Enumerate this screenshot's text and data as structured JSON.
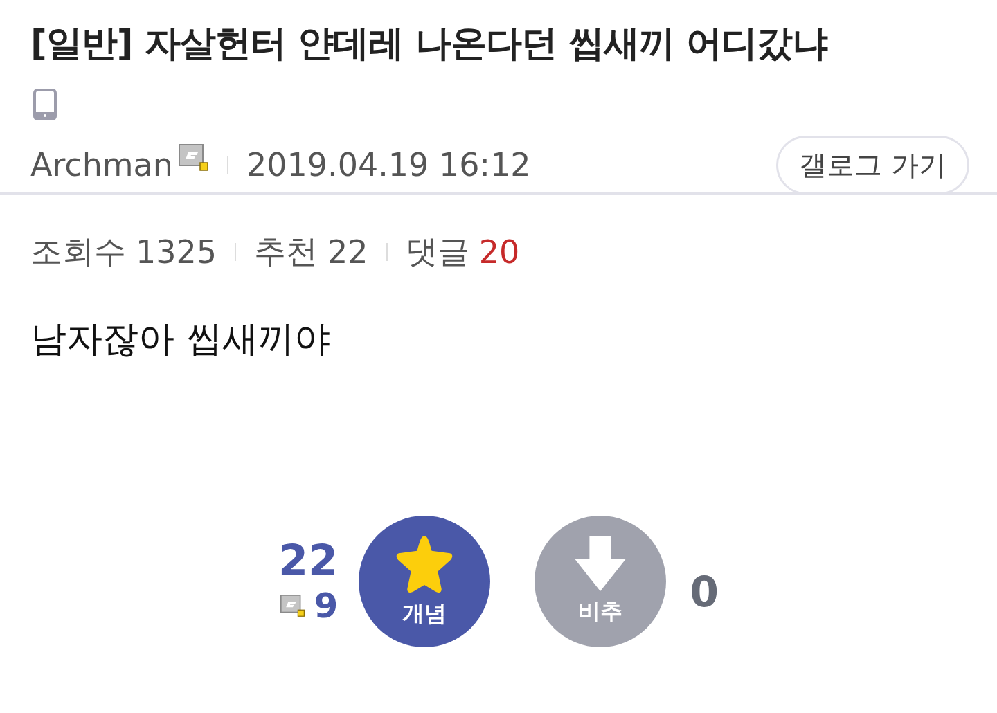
{
  "post": {
    "title": "[일반] 자살헌터 얀데레 나온다던 씹새끼 어디갔냐",
    "author": "Archman",
    "date": "2019.04.19 16:12",
    "gallog_button": "갤로그 가기",
    "stats": [
      {
        "label": "조회수",
        "value": "1325",
        "kind": "plain"
      },
      {
        "label": "추천",
        "value": "22",
        "kind": "plain"
      },
      {
        "label": "댓글",
        "value": "20",
        "kind": "highlight"
      }
    ],
    "body": "남자잖아 씹새끼야"
  },
  "votes": {
    "up_count": "22",
    "fixed_up_count": "9",
    "up_label": "개념",
    "down_label": "비추",
    "down_count": "0"
  }
}
